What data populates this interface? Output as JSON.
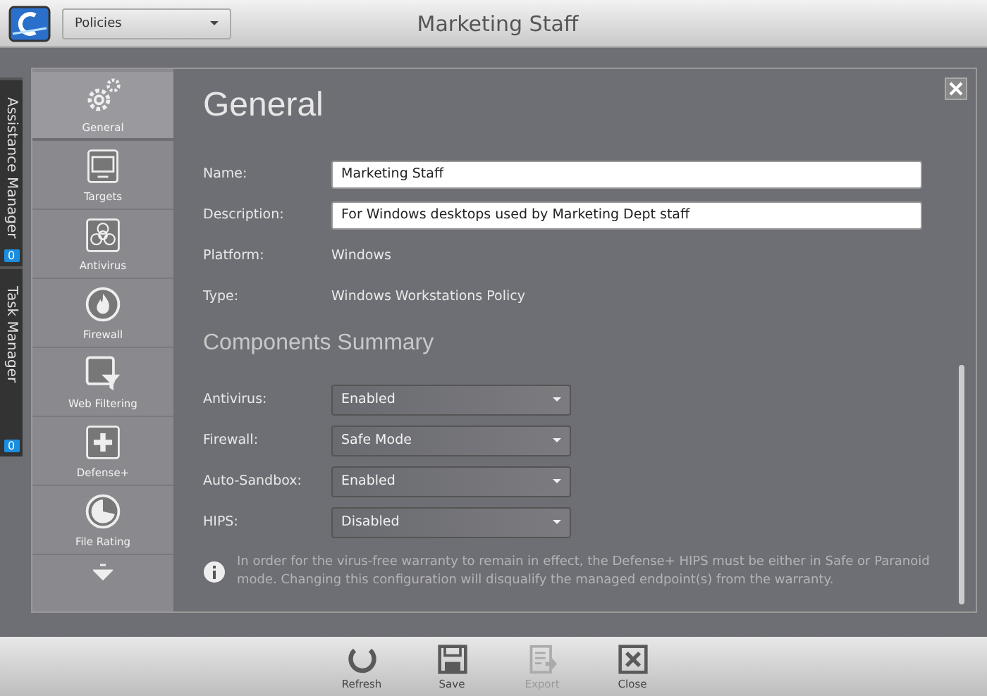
{
  "topbar": {
    "module": "Policies",
    "title": "Marketing Staff"
  },
  "side_tabs": [
    {
      "label": "Assistance Manager",
      "count": "0"
    },
    {
      "label": "Task Manager",
      "count": "0"
    }
  ],
  "nav": [
    {
      "label": "General",
      "selected": true
    },
    {
      "label": "Targets",
      "selected": false
    },
    {
      "label": "Antivirus",
      "selected": false
    },
    {
      "label": "Firewall",
      "selected": false
    },
    {
      "label": "Web Filtering",
      "selected": false
    },
    {
      "label": "Defense+",
      "selected": false
    },
    {
      "label": "File Rating",
      "selected": false
    }
  ],
  "heading": "General",
  "fields": [
    {
      "kind": "input",
      "label": "Name:",
      "value": "Marketing Staff"
    },
    {
      "kind": "input",
      "label": "Description:",
      "value": "For Windows desktops used by Marketing Dept staff"
    },
    {
      "kind": "text",
      "label": "Platform:",
      "value": "Windows"
    },
    {
      "kind": "text",
      "label": "Type:",
      "value": "Windows Workstations Policy"
    }
  ],
  "components_heading": "Components Summary",
  "components": [
    {
      "label": "Antivirus:",
      "value": "Enabled"
    },
    {
      "label": "Firewall:",
      "value": "Safe Mode"
    },
    {
      "label": "Auto-Sandbox:",
      "value": "Enabled"
    },
    {
      "label": "HIPS:",
      "value": "Disabled"
    }
  ],
  "info": "In order for the virus-free warranty to remain in effect, the Defense+ HIPS must be either in Safe or Paranoid mode. Changing this configuration will disqualify the managed endpoint(s) from the warranty.",
  "toolbar": [
    {
      "label": "Refresh",
      "disabled": false
    },
    {
      "label": "Save",
      "disabled": false
    },
    {
      "label": "Export",
      "disabled": true
    },
    {
      "label": "Close",
      "disabled": false
    }
  ]
}
